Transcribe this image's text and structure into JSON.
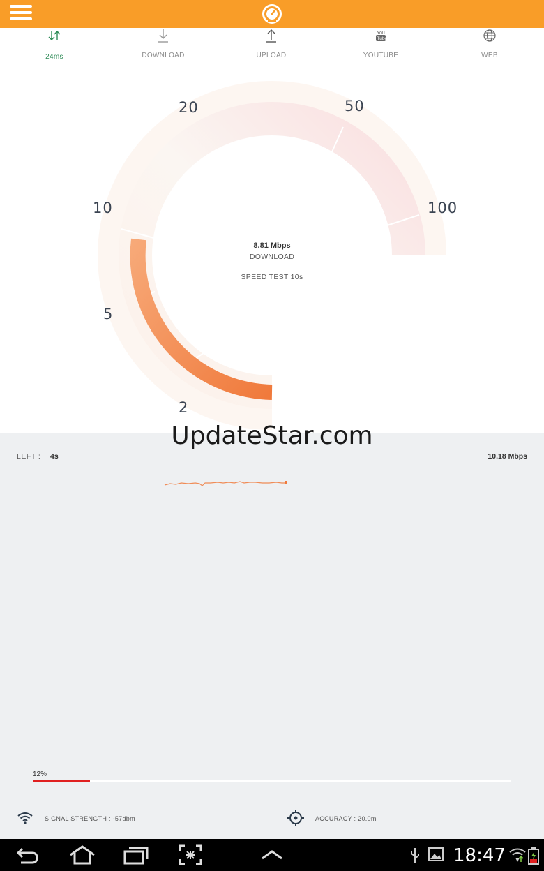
{
  "header": {
    "menu_icon": "hamburger-menu-icon",
    "logo_icon": "speedometer-logo-icon",
    "accent_color": "#f99d28"
  },
  "tabs": [
    {
      "id": "ping",
      "label": "24ms",
      "icon": "ping-arrows-icon",
      "active": true
    },
    {
      "id": "download",
      "label": "DOWNLOAD",
      "icon": "download-arrow-icon",
      "active": false
    },
    {
      "id": "upload",
      "label": "UPLOAD",
      "icon": "upload-arrow-icon",
      "active": false
    },
    {
      "id": "youtube",
      "label": "YOUTUBE",
      "icon": "youtube-icon",
      "active": false
    },
    {
      "id": "web",
      "label": "WEB",
      "icon": "globe-icon",
      "active": false
    }
  ],
  "gauge": {
    "scale_labels": [
      "2",
      "5",
      "10",
      "20",
      "50",
      "100"
    ],
    "current_speed": "8.81 Mbps",
    "mode": "DOWNLOAD",
    "test_label": "SPEED TEST 10s",
    "fill_color": "#f07a3c"
  },
  "results": {
    "left_label": "LEFT :",
    "left_value": "4s",
    "max_speed": "10.18 Mbps",
    "line_color": "#f07a3c"
  },
  "progress": {
    "label": "12%",
    "value": 0.12,
    "color": "#e02020"
  },
  "footer": {
    "signal_text": "SIGNAL STRENGTH : -57dbm",
    "signal_icon": "wifi-icon",
    "accuracy_text": "ACCURACY : 20.0m",
    "accuracy_icon": "crosshair-icon"
  },
  "watermark": "UpdateStar.com",
  "system_bar": {
    "time": "18:47",
    "buttons": [
      "back-icon",
      "home-icon",
      "recent-apps-icon",
      "screenshot-icon",
      "up-chevron-icon"
    ]
  }
}
